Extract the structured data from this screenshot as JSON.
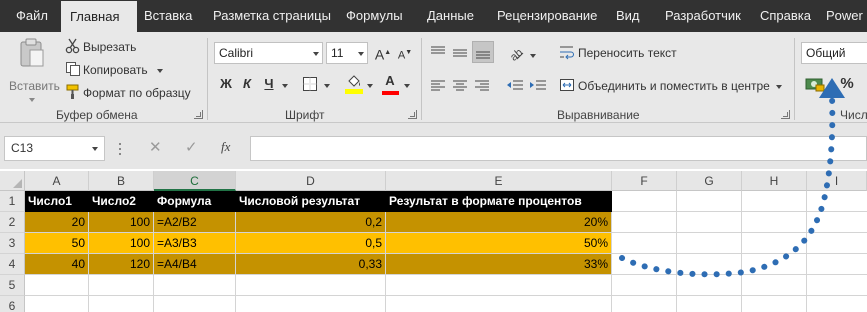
{
  "menu": {
    "tabs": [
      "Файл",
      "Главная",
      "Вставка",
      "Разметка страницы",
      "Формулы",
      "Данные",
      "Рецензирование",
      "Вид",
      "Разработчик",
      "Справка",
      "Power"
    ],
    "active_tab": "Главная"
  },
  "ribbon": {
    "clipboard": {
      "paste_label": "Вставить",
      "cut_label": "Вырезать",
      "copy_label": "Копировать",
      "format_painter_label": "Формат по образцу",
      "group_label": "Буфер обмена"
    },
    "font": {
      "font_name": "Calibri",
      "font_size": "11",
      "bold": "Ж",
      "italic": "К",
      "underline": "Ч",
      "font_color_letter": "А",
      "grow_font_letter": "A",
      "shrink_font_letter": "A",
      "group_label": "Шрифт"
    },
    "alignment": {
      "wrap_text_label": "Переносить текст",
      "merge_center_label": "Объединить и поместить в центре",
      "group_label": "Выравнивание"
    },
    "number": {
      "format_value": "Общий",
      "percent_symbol": "%",
      "group_label": "Числ"
    }
  },
  "formula_bar": {
    "name_box": "C13",
    "cancel_symbol": "✕",
    "enter_symbol": "✓",
    "fx_label": "fx",
    "formula_value": ""
  },
  "sheet": {
    "columns": [
      "A",
      "B",
      "C",
      "D",
      "E",
      "F",
      "G",
      "H",
      "I"
    ],
    "selected_column": "C",
    "rows": [
      "1",
      "2",
      "3",
      "4",
      "5",
      "6"
    ],
    "header_row": [
      "Число1",
      "Число2",
      "Формула",
      "Числовой результат",
      "Результат в формате процентов"
    ],
    "data_rows": [
      [
        "20",
        "100",
        "=A2/B2",
        "0,2",
        "20%"
      ],
      [
        "50",
        "100",
        "=A3/B3",
        "0,5",
        "50%"
      ],
      [
        "40",
        "120",
        "=A4/B4",
        "0,33",
        "33%"
      ]
    ]
  },
  "colors": {
    "menu_bar": "#323232",
    "ribbon": "#e8e8e8",
    "header_fill": "#000000",
    "row_dark_gold": "#c59200",
    "row_gold": "#ffc000",
    "arrow_blue": "#2e6db4",
    "fill_color_bar": "#ffff00",
    "font_color_bar": "#ff0000"
  },
  "icons": {
    "paste": "clipboard-icon",
    "cut": "scissors-icon",
    "copy": "copy-icon",
    "format_painter": "paintbrush-icon",
    "borders": "borders-icon",
    "fill": "fill-bucket-icon",
    "wrap": "wrap-text-icon",
    "merge": "merge-cells-icon",
    "currency": "currency-icon"
  }
}
